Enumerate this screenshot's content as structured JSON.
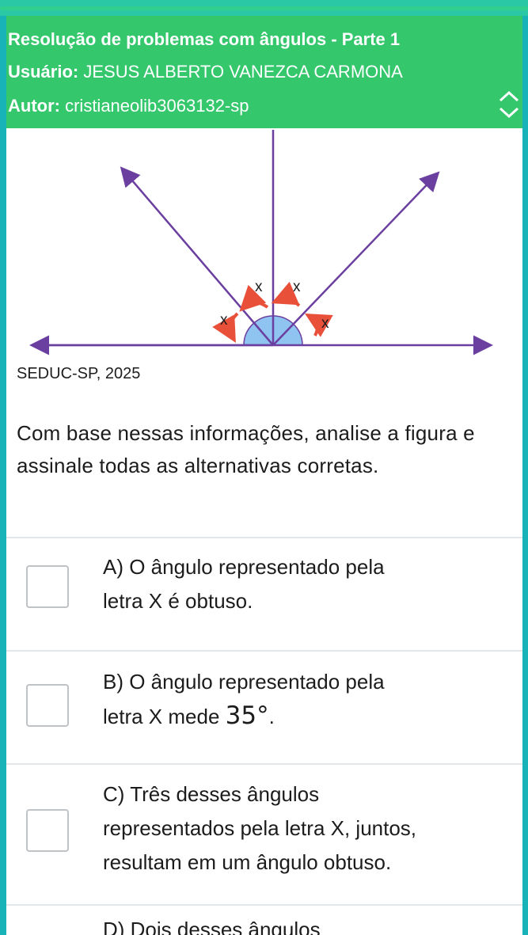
{
  "header": {
    "title": "Resolução de problemas com ângulos - Parte 1",
    "user_label": "Usuário:",
    "user_value": "JESUS ALBERTO VANEZCA CARMONA",
    "author_label": "Autor:",
    "author_value": "cristianeolib3063132-sp",
    "toggle_icon": "chevron-up-down-icon"
  },
  "figure": {
    "angle_labels": [
      "x",
      "x",
      "x",
      "x"
    ],
    "colors": {
      "rays": "#6b3fa0",
      "arc_fill": "#8fc3f0",
      "arrow": "#e8503a",
      "axis": "#6b3fa0"
    },
    "source": "SEDUC-SP, 2025"
  },
  "prompt": "Com base nessas informações, analise a figura e assinale todas as alternativas corretas.",
  "options": [
    {
      "line1": "A) O ângulo representado pela",
      "line2": "letra X é obtuso."
    },
    {
      "line1": "B) O ângulo representado pela",
      "line2_pre": "letra X mede ",
      "line2_value": "35°",
      "line2_post": "."
    },
    {
      "line1": "C) Três desses ângulos",
      "line2": "representados pela letra X, juntos,",
      "line3": "resultam em um ângulo obtuso."
    }
  ],
  "next_option_partial": "D) Dois desses ângulos"
}
